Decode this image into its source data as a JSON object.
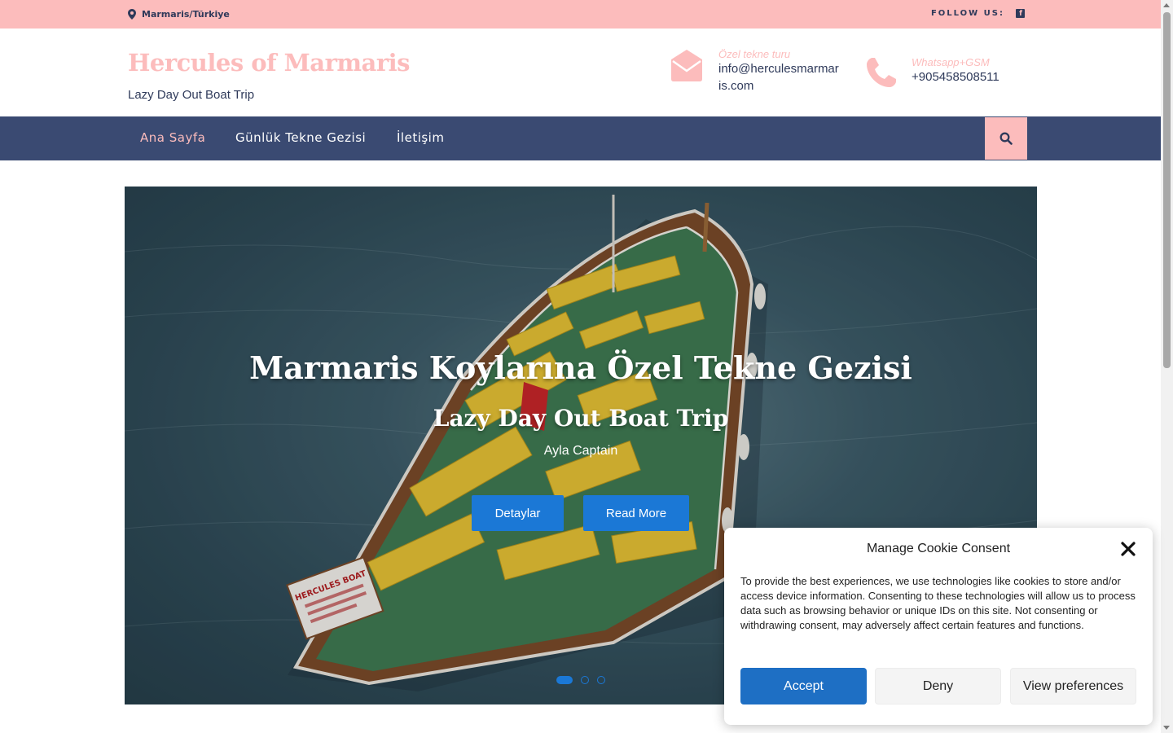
{
  "topbar": {
    "location": "Marmaris/Türkiye",
    "follow_label": "FOLLOW US:",
    "facebook_glyph": "f"
  },
  "header": {
    "site_title": "Hercules of Marmaris",
    "tagline": "Lazy Day Out Boat Trip",
    "email": {
      "label": "Özel tekne turu",
      "value": "info@herculesmarmaris.com",
      "icon": "envelope-icon"
    },
    "phone": {
      "label": "Whatsapp+GSM",
      "value": "+905458508511",
      "icon": "phone-icon"
    }
  },
  "nav": {
    "items": [
      {
        "label": "Ana Sayfa",
        "active": true
      },
      {
        "label": "Günlük Tekne Gezisi",
        "active": false
      },
      {
        "label": "İletişim",
        "active": false
      }
    ],
    "search_icon": "search-icon"
  },
  "hero": {
    "title": "Marmaris Koylarına Özel Tekne Gezisi",
    "subtitle": "Lazy Day Out Boat Trip",
    "caption": "Ayla Captain",
    "button_details": "Detaylar",
    "button_read_more": "Read More",
    "boat_sign": "HERCULES BOAT",
    "slide_count": 3,
    "active_slide": 1
  },
  "cookie": {
    "title": "Manage Cookie Consent",
    "body": "To provide the best experiences, we use technologies like cookies to store and/or access device information. Consenting to these technologies will allow us to process data such as browsing behavior or unique IDs on this site. Not consenting or withdrawing consent, may adversely affect certain features and functions.",
    "accept": "Accept",
    "deny": "Deny",
    "view_preferences": "View preferences"
  },
  "colors": {
    "pink": "#fcbcbc",
    "navy": "#3a4a72",
    "blue": "#1b78d6"
  }
}
